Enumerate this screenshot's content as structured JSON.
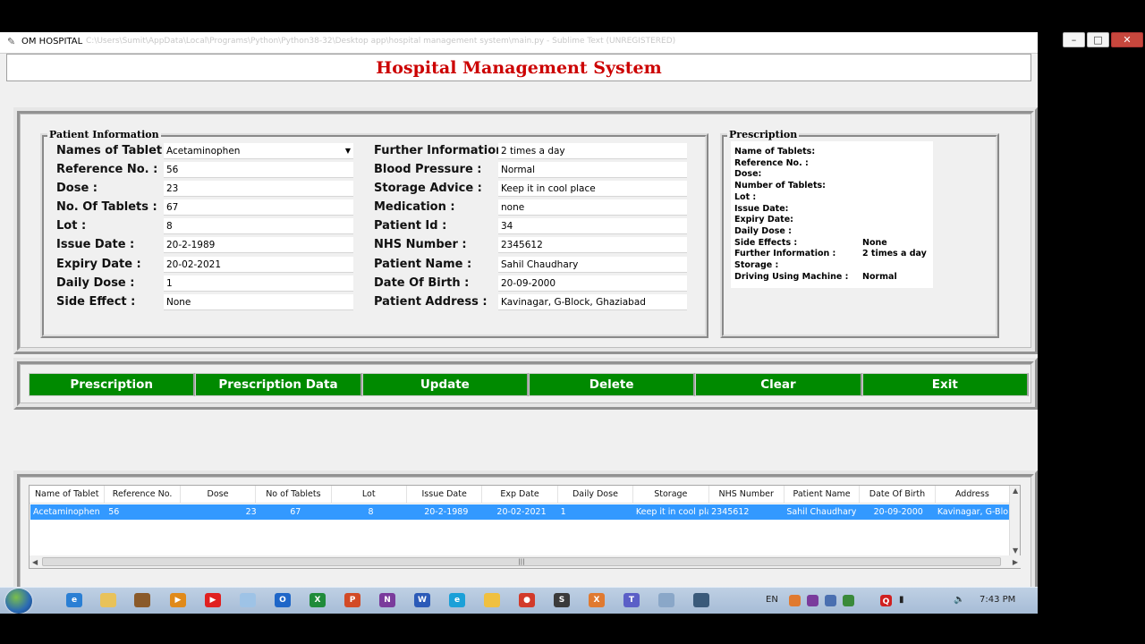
{
  "window": {
    "title": "OM HOSPITAL",
    "path": "C:\\Users\\Sumit\\AppData\\Local\\Programs\\Python\\Python38-32\\Desktop app\\hospital management system\\main.py - Sublime Text (UNREGISTERED)"
  },
  "app": {
    "heading": "Hospital Management System"
  },
  "patient_info": {
    "legend": "Patient Information",
    "left_fields": [
      {
        "label": "Names of Tablet :",
        "value": "Acetaminophen"
      },
      {
        "label": "Reference No. :",
        "value": "56"
      },
      {
        "label": "Dose :",
        "value": "23"
      },
      {
        "label": "No. Of Tablets :",
        "value": "67"
      },
      {
        "label": "Lot :",
        "value": "8"
      },
      {
        "label": "Issue Date :",
        "value": "20-2-1989"
      },
      {
        "label": "Expiry Date :",
        "value": "20-02-2021"
      },
      {
        "label": "Daily Dose :",
        "value": "1"
      },
      {
        "label": "Side Effect :",
        "value": "None"
      }
    ],
    "right_fields": [
      {
        "label": "Further Information :",
        "value": "2 times a day"
      },
      {
        "label": "Blood Pressure :",
        "value": "Normal"
      },
      {
        "label": "Storage Advice :",
        "value": "Keep it in cool place"
      },
      {
        "label": "Medication :",
        "value": "none"
      },
      {
        "label": "Patient Id :",
        "value": "34"
      },
      {
        "label": "NHS Number :",
        "value": "2345612"
      },
      {
        "label": "Patient Name :",
        "value": "Sahil Chaudhary"
      },
      {
        "label": "Date Of Birth :",
        "value": "20-09-2000"
      },
      {
        "label": "Patient Address :",
        "value": "Kavinagar, G-Block, Ghaziabad"
      }
    ]
  },
  "prescription": {
    "legend": "Prescription",
    "lines": [
      {
        "label": "Name of Tablets:",
        "value": ""
      },
      {
        "label": "Reference No. :",
        "value": ""
      },
      {
        "label": "Dose:",
        "value": ""
      },
      {
        "label": "Number of Tablets:",
        "value": ""
      },
      {
        "label": "Lot :",
        "value": ""
      },
      {
        "label": "Issue Date:",
        "value": ""
      },
      {
        "label": "Expiry Date:",
        "value": ""
      },
      {
        "label": "Daily Dose :",
        "value": ""
      },
      {
        "label": "Side Effects :",
        "value": "None"
      },
      {
        "label": "Further Information :",
        "value": "2 times a day"
      },
      {
        "label": "Storage :",
        "value": ""
      },
      {
        "label": "Driving Using Machine :",
        "value": "Normal"
      }
    ]
  },
  "buttons": [
    "Prescription",
    "Prescription Data",
    "Update",
    "Delete",
    "Clear",
    "Exit"
  ],
  "table": {
    "columns": [
      "Name of Tablet",
      "Reference No.",
      "Dose",
      "No of Tablets",
      "Lot",
      "Issue Date",
      "Exp Date",
      "Daily Dose",
      "Storage",
      "NHS Number",
      "Patient Name",
      "Date Of Birth",
      "Address"
    ],
    "rows": [
      [
        "Acetaminophen",
        "56",
        "23",
        "67",
        "8",
        "20-2-1989",
        "20-02-2021",
        "1",
        "Keep it in cool pla",
        "2345612",
        "Sahil Chaudhary",
        "20-09-2000",
        "Kavinagar, G-Blo"
      ]
    ],
    "selected_row": 0
  },
  "taskbar": {
    "language": "EN",
    "time": "7:43 PM"
  },
  "colors": {
    "heading": "#cc0000",
    "button_bg": "#008a00",
    "selection": "#3399ff"
  }
}
